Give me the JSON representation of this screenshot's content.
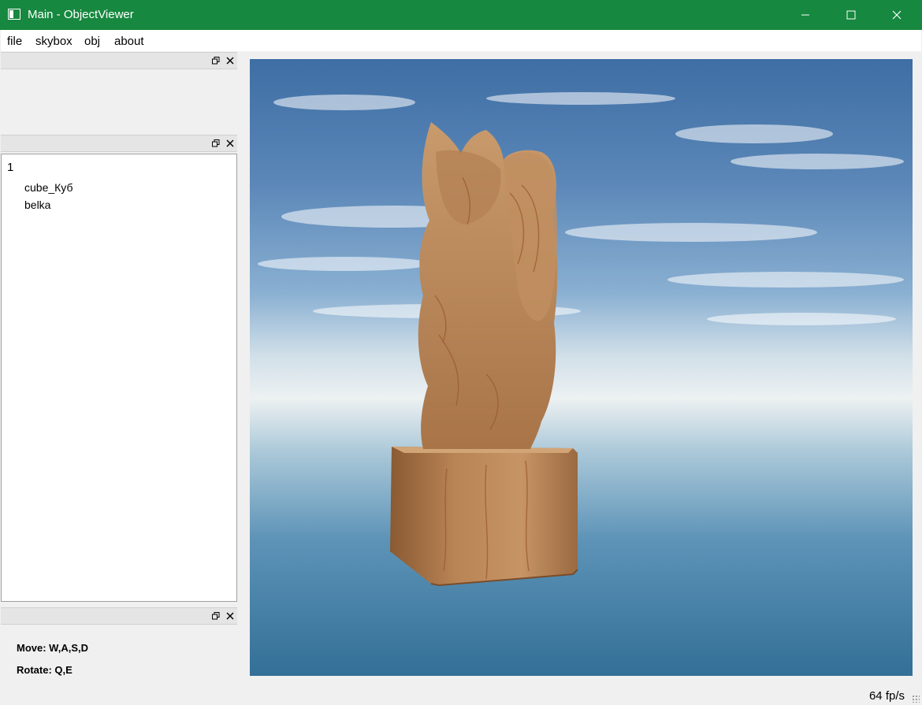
{
  "window": {
    "title": "Main - ObjectViewer",
    "accent_color": "#16883f"
  },
  "menu": {
    "items": [
      "file",
      "skybox",
      "obj",
      "about"
    ]
  },
  "tree": {
    "root": "1",
    "children": [
      "cube_Куб",
      "belka"
    ]
  },
  "help": {
    "move": "Move: W,A,S,D",
    "rotate": "Rotate: Q,E"
  },
  "status": {
    "fps": "64 fp/s"
  },
  "icons": {
    "minimize": "minimize-icon",
    "maximize": "maximize-icon",
    "close": "close-icon",
    "dock_float": "dock-float-icon",
    "dock_close": "dock-close-icon"
  },
  "scene": {
    "description_visible": false
  }
}
